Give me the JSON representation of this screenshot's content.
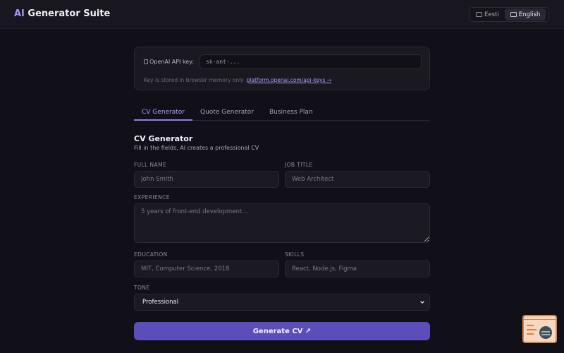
{
  "header": {
    "brand_ai": "AI",
    "brand_rest": " Generator Suite",
    "languages": [
      {
        "label": "Eesti",
        "active": false
      },
      {
        "label": "English",
        "active": true
      }
    ]
  },
  "api": {
    "label": "OpenAI API key:",
    "placeholder": "sk-ant-...",
    "note": "Key is stored in browser memory only",
    "link": "platform.openai.com/api-keys →"
  },
  "tabs": [
    {
      "label": "CV Generator",
      "active": true
    },
    {
      "label": "Quote Generator",
      "active": false
    },
    {
      "label": "Business Plan",
      "active": false
    }
  ],
  "form": {
    "title": "CV Generator",
    "subtitle": "Fill in the fields, AI creates a professional CV",
    "full_name": {
      "label": "FULL NAME",
      "placeholder": "John Smith"
    },
    "job_title": {
      "label": "JOB TITLE",
      "placeholder": "Web Architect"
    },
    "experience": {
      "label": "EXPERIENCE",
      "placeholder": "5 years of front-end development..."
    },
    "education": {
      "label": "EDUCATION",
      "placeholder": "MIT, Computer Science, 2018"
    },
    "skills": {
      "label": "SKILLS",
      "placeholder": "React, Node.js, Figma"
    },
    "tone": {
      "label": "TONE",
      "value": "Professional"
    },
    "submit": "Generate CV ↗"
  },
  "colors": {
    "accent": "#8f7ff2",
    "button": "#5b4dba",
    "background": "#111018"
  }
}
